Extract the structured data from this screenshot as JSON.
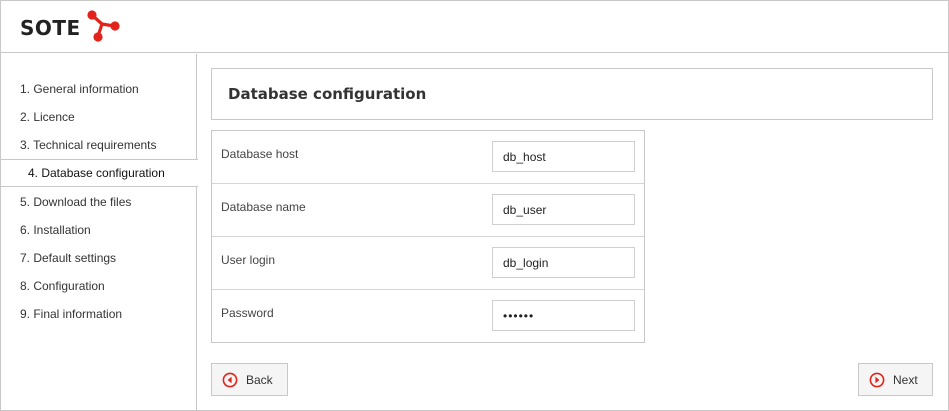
{
  "header": {
    "brand": "SOTE",
    "accent_color": "#e2231a"
  },
  "sidebar": {
    "steps": [
      {
        "label": "1. General information"
      },
      {
        "label": "2. Licence"
      },
      {
        "label": "3. Technical requirements"
      },
      {
        "label": "4. Database configuration",
        "active": true
      },
      {
        "label": "5. Download the files"
      },
      {
        "label": "6. Installation"
      },
      {
        "label": "7. Default settings"
      },
      {
        "label": "8. Configuration"
      },
      {
        "label": "9. Final information"
      }
    ]
  },
  "main": {
    "title": "Database configuration",
    "fields": [
      {
        "label": "Database host",
        "value": "db_host"
      },
      {
        "label": "Database name",
        "value": "db_user"
      },
      {
        "label": "User login",
        "value": "db_login"
      },
      {
        "label": "Password",
        "value": "••••••"
      }
    ],
    "back_label": "Back",
    "next_label": "Next"
  }
}
